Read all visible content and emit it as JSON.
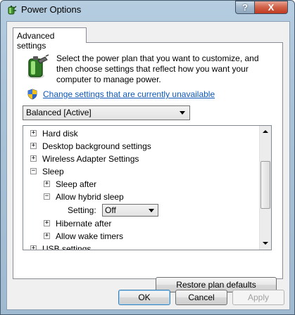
{
  "window": {
    "title": "Power Options",
    "help_glyph": "?",
    "close_glyph": "X"
  },
  "tab": {
    "label": "Advanced settings"
  },
  "intro": {
    "text": "Select the power plan that you want to customize, and then choose settings that reflect how you want your computer to manage power."
  },
  "change_link": {
    "label": "Change settings that are currently unavailable"
  },
  "plan_select": {
    "value": "Balanced [Active]"
  },
  "tree": {
    "rows": [
      {
        "label": "Hard disk",
        "expander": "+"
      },
      {
        "label": "Desktop background settings",
        "expander": "+"
      },
      {
        "label": "Wireless Adapter Settings",
        "expander": "+"
      },
      {
        "label": "Sleep",
        "expander": "−"
      },
      {
        "label": "Sleep after",
        "expander": "+"
      },
      {
        "label": "Allow hybrid sleep",
        "expander": "−"
      },
      {
        "label": "Hibernate after",
        "expander": "+"
      },
      {
        "label": "Allow wake timers",
        "expander": "+"
      },
      {
        "label": "USB settings",
        "expander": "+"
      }
    ],
    "setting": {
      "label": "Setting:",
      "value": "Off"
    }
  },
  "buttons": {
    "restore": "Restore plan defaults",
    "ok": "OK",
    "cancel": "Cancel",
    "apply": "Apply"
  },
  "colors": {
    "link": "#0c56b8",
    "close_button": "#c03a1e",
    "title_bar": "#a9c3d9"
  }
}
